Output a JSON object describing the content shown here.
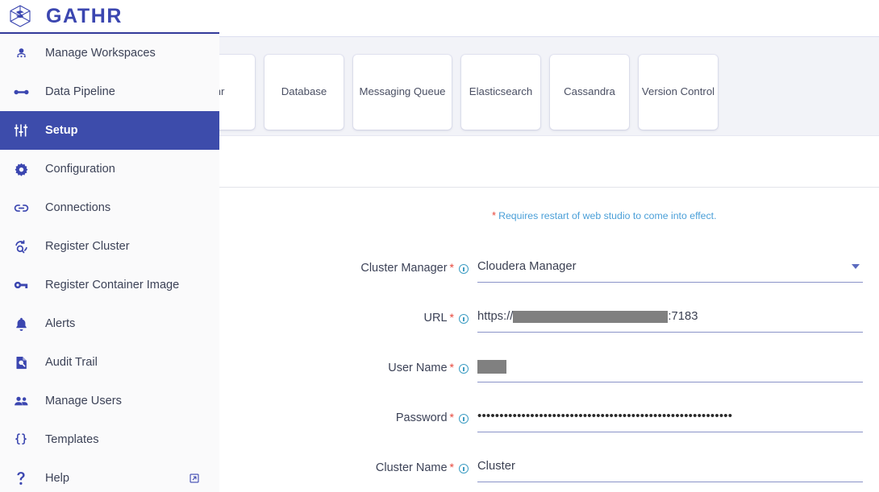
{
  "brand": {
    "name": "GATHR",
    "logo_icon": "gathr-cube-logo",
    "accent_color": "#3b46b0",
    "active_nav_color": "#3d4cab"
  },
  "sidebar": {
    "items": [
      {
        "label": "Manage Workspaces",
        "icon": "person-dots-icon",
        "active": false
      },
      {
        "label": "Data Pipeline",
        "icon": "pipeline-icon",
        "active": false
      },
      {
        "label": "Setup",
        "icon": "sliders-icon",
        "active": true
      },
      {
        "label": "Configuration",
        "icon": "gear-icon",
        "active": false
      },
      {
        "label": "Connections",
        "icon": "link-icon",
        "active": false
      },
      {
        "label": "Register Cluster",
        "icon": "refresh-search-icon",
        "active": false
      },
      {
        "label": "Register Container Image",
        "icon": "key-icon",
        "active": false
      },
      {
        "label": "Alerts",
        "icon": "bell-icon",
        "active": false
      },
      {
        "label": "Audit Trail",
        "icon": "document-search-icon",
        "active": false
      },
      {
        "label": "Manage Users",
        "icon": "users-icon",
        "active": false
      },
      {
        "label": "Templates",
        "icon": "braces-icon",
        "active": false
      },
      {
        "label": "Help",
        "icon": "question-mark-icon",
        "active": false,
        "external_icon": "external-link-icon"
      }
    ]
  },
  "tabs": [
    {
      "label": "athr"
    },
    {
      "label": "Database"
    },
    {
      "label": "Messaging Queue"
    },
    {
      "label": "Elasticsearch"
    },
    {
      "label": "Cassandra"
    },
    {
      "label": "Version Control"
    }
  ],
  "form": {
    "note_star": "*",
    "note_text": "Requires restart of web studio to come into effect.",
    "note_color": "#4a9fd8",
    "required_star": "*",
    "info_icon": "info-circle-icon",
    "fields": [
      {
        "label": "Cluster Manager",
        "type": "select",
        "value": "Cloudera Manager",
        "caret_icon": "chevron-down-icon"
      },
      {
        "label": "URL",
        "type": "text-redacted",
        "value_prefix": "https://",
        "value_suffix": ":7183",
        "redaction_color": "#808080"
      },
      {
        "label": "User Name",
        "type": "text-redacted",
        "value_prefix": "",
        "value_suffix": "",
        "redaction_color": "#808080"
      },
      {
        "label": "Password",
        "type": "password",
        "value": "••••••••••••••••••••••••••••••••••••••••••••••••••••••••••"
      },
      {
        "label": "Cluster Name",
        "type": "text",
        "value": "Cluster"
      }
    ]
  }
}
